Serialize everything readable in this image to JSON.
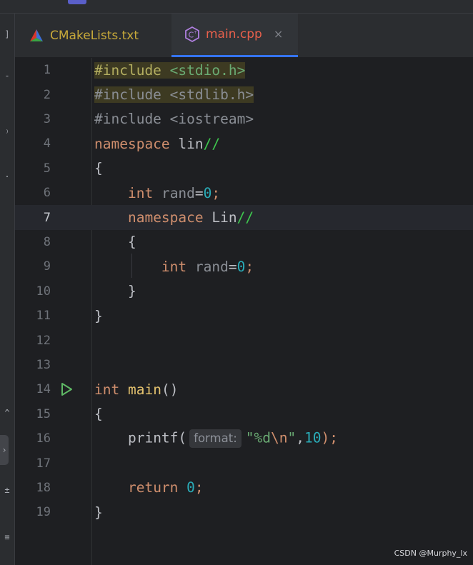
{
  "tabs": [
    {
      "label": "CMakeLists.txt",
      "icon": "cmake-triangle-icon",
      "active": false
    },
    {
      "label": "main.cpp",
      "icon": "cpp-file-icon",
      "active": true,
      "close": "×"
    }
  ],
  "toolstrip_glyphs": [
    "]",
    "-",
    "⁾",
    ".",
    "^",
    "›",
    "±",
    "≡"
  ],
  "editor": {
    "current_line": 7,
    "lines": [
      {
        "n": "1"
      },
      {
        "n": "2"
      },
      {
        "n": "3"
      },
      {
        "n": "4"
      },
      {
        "n": "5"
      },
      {
        "n": "6"
      },
      {
        "n": "7"
      },
      {
        "n": "8"
      },
      {
        "n": "9"
      },
      {
        "n": "10"
      },
      {
        "n": "11"
      },
      {
        "n": "12"
      },
      {
        "n": "13"
      },
      {
        "n": "14"
      },
      {
        "n": "15"
      },
      {
        "n": "16"
      },
      {
        "n": "17"
      },
      {
        "n": "18"
      },
      {
        "n": "19"
      }
    ],
    "code": {
      "l1_pre": "#include",
      "l1_hdr": "<stdio.h>",
      "l2_pre": "#include",
      "l2_hdr": "<stdlib.h>",
      "l3_pre": "#include",
      "l3_hdr": "<iostream>",
      "kw_namespace": "namespace",
      "ns_lin": "lin",
      "comment": "//",
      "brace_open": "{",
      "brace_close": "}",
      "kw_int": "int",
      "var_rand": "rand",
      "eq": "=",
      "zero": "0",
      "semi": ";",
      "ns_Lin": "Lin",
      "fn_main": "main",
      "parens": "()",
      "fn_printf": "printf(",
      "inlay_format": "format:",
      "str_open": "\"%d",
      "str_esc": "\\n",
      "str_close": "\"",
      "comma": ",",
      "ten": "10",
      "close_paren_semi": ");",
      "kw_return": "return"
    }
  },
  "watermark": "CSDN @Murphy_lx",
  "colors": {
    "keyword": "#cf8e6d",
    "number": "#2aacb8",
    "string": "#6aab73",
    "preprocessor": "#b3ae60",
    "tab_active_underline": "#3574f0"
  }
}
